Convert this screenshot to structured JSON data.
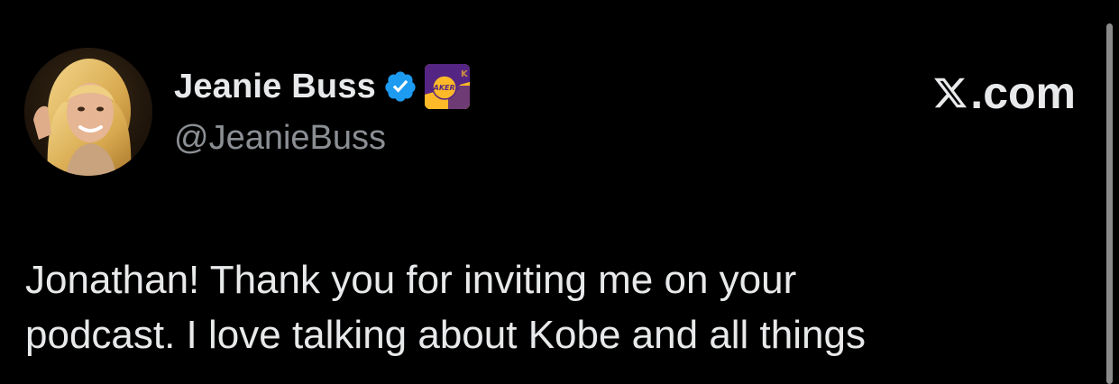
{
  "tweet": {
    "author": {
      "display_name": "Jeanie Buss",
      "handle": "@JeanieBuss",
      "verified": true,
      "verified_color": "#1d9bf0",
      "affiliate_badge": "lakers-logo-icon",
      "affiliate_label": "LAKERS"
    },
    "text_lines": [
      "Jonathan! Thank you for inviting me on your",
      "podcast. I love talking about Kobe and all things"
    ]
  },
  "brand": {
    "suffix": ".com",
    "icon": "x-logo-icon"
  },
  "colors": {
    "background": "#000000",
    "text": "#e7e9ea",
    "secondary_text": "#8b8f94",
    "lakers_purple": "#552583",
    "lakers_gold": "#fdb927"
  }
}
